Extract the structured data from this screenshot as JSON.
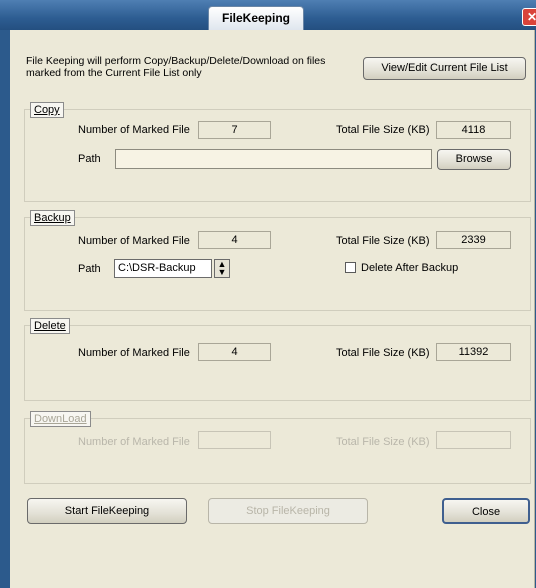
{
  "window": {
    "title": "FileKeeping",
    "close_glyph": "✕"
  },
  "intro": {
    "text": "File Keeping will perform Copy/Backup/Delete/Download on files marked from the Current File List only",
    "view_edit_button": "View/Edit Current File List"
  },
  "copy": {
    "label": "Copy",
    "marked_label": "Number of Marked File",
    "marked_value": "7",
    "size_label": "Total File Size (KB)",
    "size_value": "4118",
    "path_label": "Path",
    "path_value": "",
    "browse_button": "Browse"
  },
  "backup": {
    "label": "Backup",
    "marked_label": "Number of Marked File",
    "marked_value": "4",
    "size_label": "Total File Size (KB)",
    "size_value": "2339",
    "path_label": "Path",
    "path_value": "C:\\DSR-Backup",
    "delete_after_label": "Delete After Backup",
    "delete_after_checked": false
  },
  "delete": {
    "label": "Delete",
    "marked_label": "Number of Marked File",
    "marked_value": "4",
    "size_label": "Total File Size (KB)",
    "size_value": "11392"
  },
  "download": {
    "label": "DownLoad",
    "marked_label": "Number of Marked File",
    "marked_value": "",
    "size_label": "Total File Size (KB)",
    "size_value": ""
  },
  "buttons": {
    "start": "Start FileKeeping",
    "stop": "Stop FileKeeping",
    "close": "Close"
  }
}
